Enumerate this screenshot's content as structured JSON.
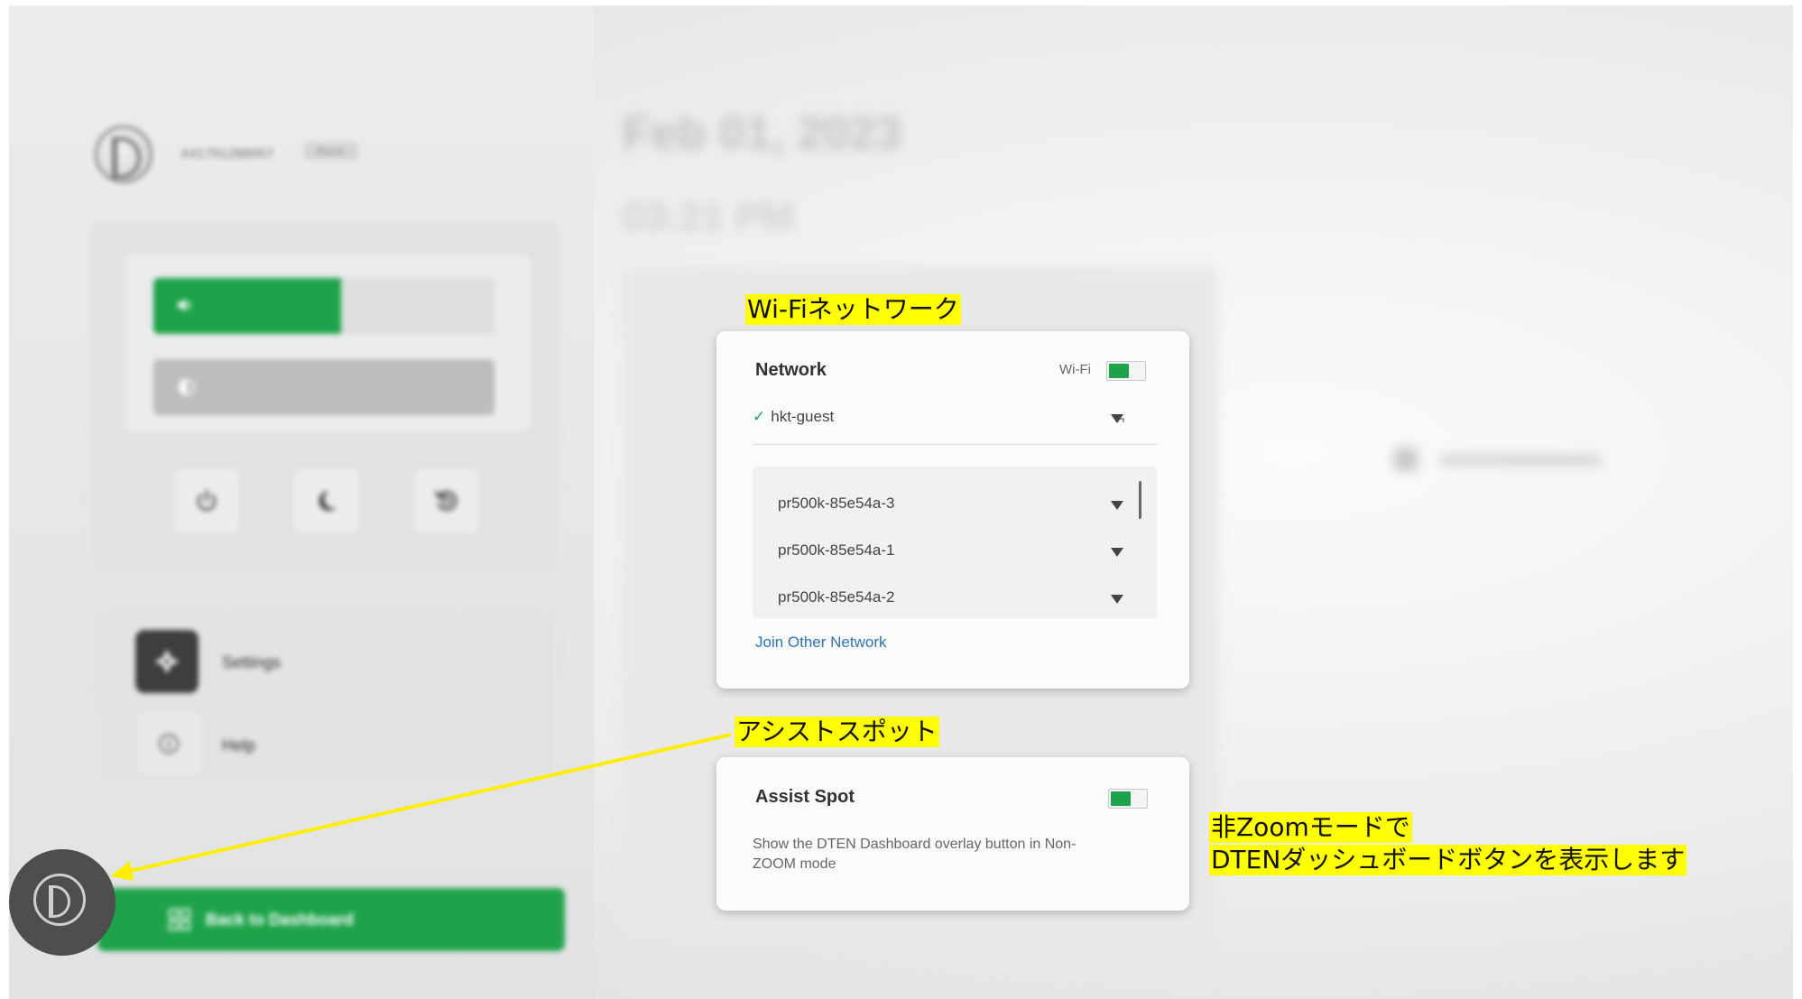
{
  "profile": {
    "device_id": "A4179128B957",
    "plan_badge": "Basic"
  },
  "controls": {
    "volume_level": 0.55,
    "brightness_level": 0.0,
    "buttons": [
      "power-icon",
      "moon-icon",
      "restart-icon"
    ]
  },
  "menu": {
    "settings_label": "Settings",
    "help_label": "Help"
  },
  "back_to_dashboard": "Back to Dashboard",
  "background": {
    "date": "Feb 01, 2023",
    "time": "03:21 PM"
  },
  "network": {
    "title": "Network",
    "wifi_label": "Wi-Fi",
    "wifi_enabled": true,
    "connected": "hkt-guest",
    "available": [
      "pr500k-85e54a-3",
      "pr500k-85e54a-1",
      "pr500k-85e54a-2"
    ],
    "join_other": "Join Other Network"
  },
  "assist_spot": {
    "title": "Assist Spot",
    "enabled": true,
    "description": "Show the DTEN Dashboard overlay button in Non-ZOOM mode"
  },
  "annotations": {
    "wifi": "Wi-Fiネットワーク",
    "assist": "アシストスポット",
    "nonzoom_line1": "非Zoomモードで",
    "nonzoom_line2": "DTENダッシュボードボタンを表示します"
  },
  "colors": {
    "accent": "#1ea34a",
    "annotation_bg": "#ffff00",
    "arrow": "#ffee00",
    "link": "#2d74b5"
  }
}
